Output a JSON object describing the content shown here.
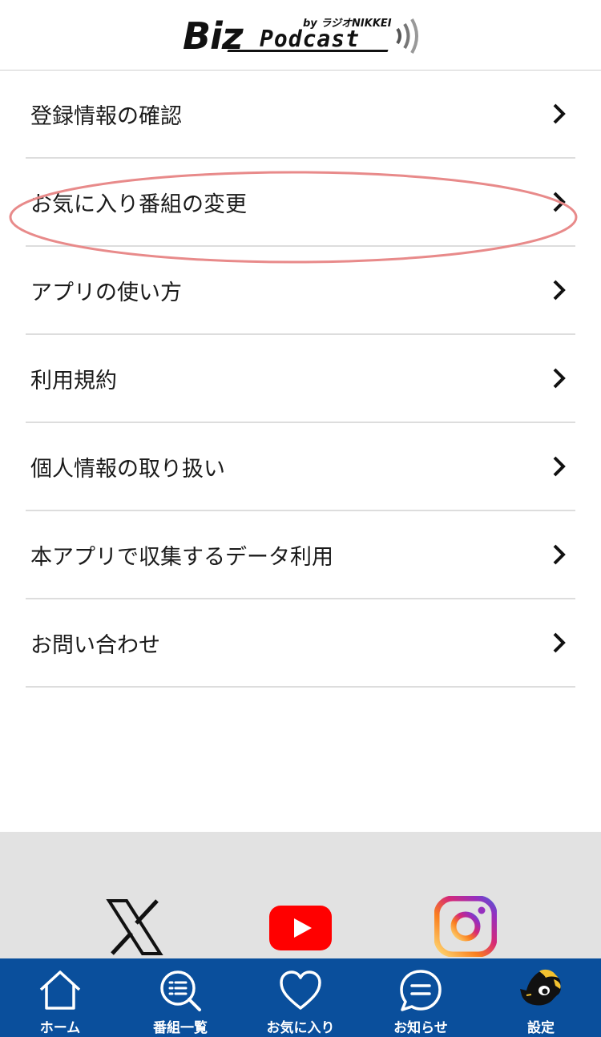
{
  "header": {
    "logo_biz": "Biz",
    "logo_podcast": "Podcast",
    "logo_by": "by ラジオNIKKEI"
  },
  "menu": {
    "items": [
      {
        "label": "登録情報の確認"
      },
      {
        "label": "お気に入り番組の変更",
        "highlighted": true
      },
      {
        "label": "アプリの使い方"
      },
      {
        "label": "利用規約"
      },
      {
        "label": "個人情報の取り扱い"
      },
      {
        "label": "本アプリで収集するデータ利用"
      },
      {
        "label": "お問い合わせ"
      }
    ]
  },
  "social": {
    "links": [
      {
        "icon": "x-logo-icon"
      },
      {
        "icon": "youtube-icon"
      },
      {
        "icon": "instagram-icon"
      }
    ]
  },
  "tabbar": {
    "tabs": [
      {
        "label": "ホーム",
        "icon": "home-icon"
      },
      {
        "label": "番組一覧",
        "icon": "search-list-icon"
      },
      {
        "label": "お気に入り",
        "icon": "heart-icon"
      },
      {
        "label": "お知らせ",
        "icon": "chat-bubble-icon"
      },
      {
        "label": "設定",
        "icon": "mascot-icon",
        "active": true
      }
    ]
  },
  "colors": {
    "tabbar_bg": "#0a4f9c",
    "highlight_oval": "#e88a8a",
    "social_bg": "#e2e2e2",
    "youtube_red": "#ff0000"
  }
}
